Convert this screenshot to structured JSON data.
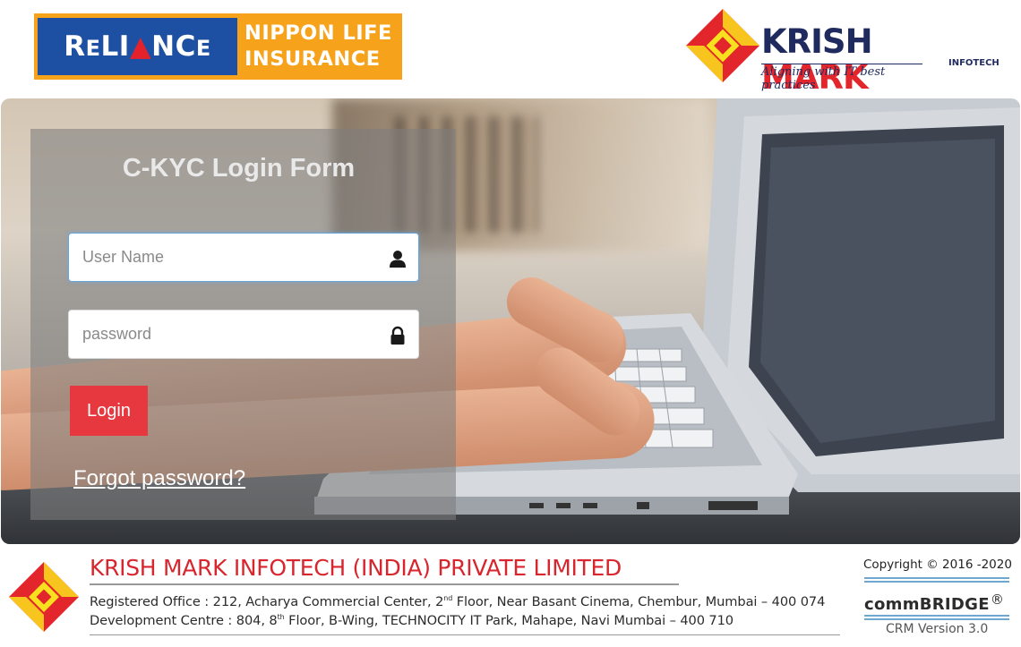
{
  "header": {
    "reliance_logo": {
      "word": "RELIANCE",
      "line1": "NIPPON LIFE",
      "line2": "INSURANCE"
    },
    "krish_logo": {
      "word1": "KRISH",
      "word2": "MARK",
      "small": "INFOTECH",
      "tagline": "Aligning with IT best practices"
    }
  },
  "login": {
    "title": "C-KYC Login Form",
    "username_placeholder": "User Name",
    "password_placeholder": "password",
    "username_icon": "user-icon",
    "password_icon": "lock-icon",
    "login_label": "Login",
    "forgot_label": "Forgot password?"
  },
  "footer": {
    "company": "KRISH MARK INFOTECH (INDIA) PRIVATE LIMITED",
    "reg_office_a": "Registered Office : 212, Acharya Commercial Center, 2",
    "reg_office_sup": "nd",
    "reg_office_b": " Floor, Near Basant Cinema, Chembur, Mumbai – 400 074",
    "dev_centre_a": "Development Centre : 804, 8",
    "dev_centre_sup": "th",
    "dev_centre_b": " Floor, B-Wing, TECHNOCITY IT Park, Mahape, Navi Mumbai – 400 710",
    "copyright": "Copyright © 2016 -2020",
    "product": "commBRIDGE",
    "registered_mark": "®",
    "version": "CRM Version 3.0"
  },
  "colors": {
    "reliance_orange": "#f7a21b",
    "reliance_blue": "#1d50a2",
    "brand_red": "#e3262b",
    "brand_navy": "#1f2a5e",
    "login_button": "#e8383f",
    "rule_blue": "#6fa8cf"
  }
}
